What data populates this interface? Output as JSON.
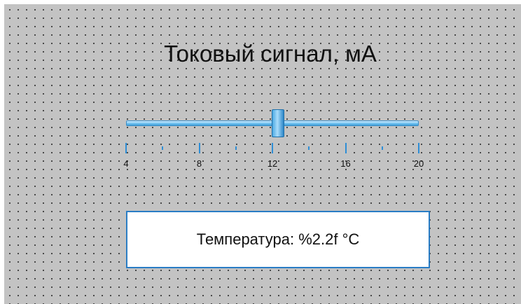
{
  "title": "Токовый сигнал, мА",
  "slider": {
    "min": 4,
    "max": 20,
    "value": 12.3,
    "major_ticks": [
      "4",
      "8",
      "12",
      "16",
      "20"
    ],
    "minor_tick_values": [
      6,
      10,
      14,
      18
    ]
  },
  "display": {
    "text": "Температура: %2.2f °C"
  },
  "colors": {
    "background": "#c3c3c3",
    "accent": "#2a7dc5",
    "track": "#6fc1f0"
  }
}
